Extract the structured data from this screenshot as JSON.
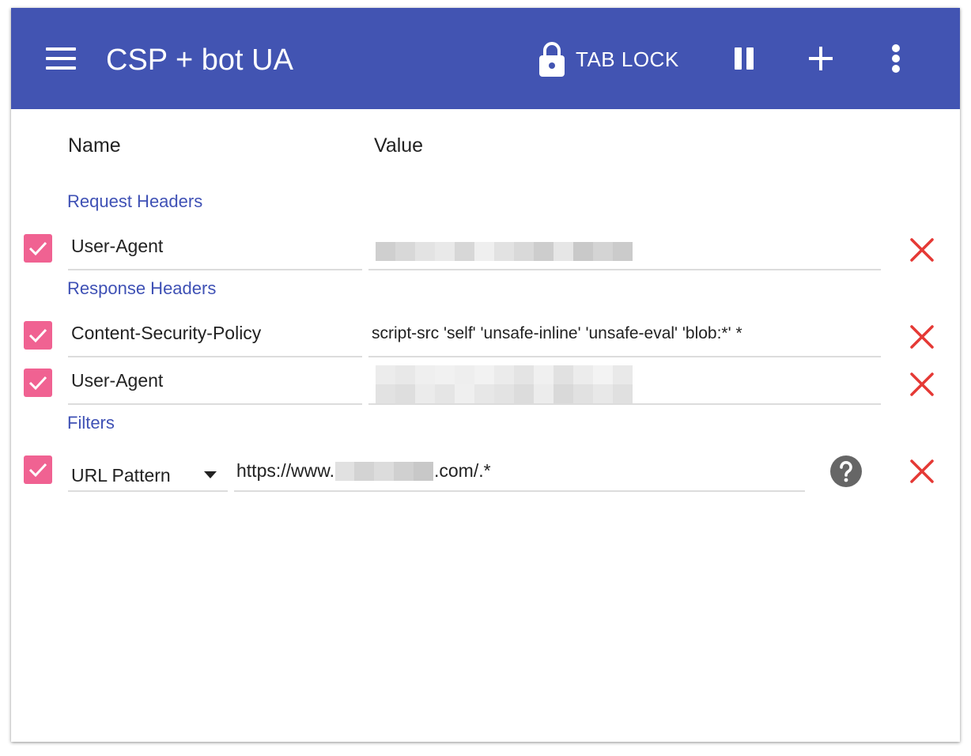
{
  "app": {
    "title": "CSP + bot UA",
    "menu_icon": "hamburger-menu-icon",
    "tab_lock_label": "TAB LOCK",
    "actions": [
      "lock-icon",
      "pause-icon",
      "add-icon",
      "more-vert-icon"
    ]
  },
  "columns": {
    "name": "Name",
    "value": "Value"
  },
  "sections": {
    "request": "Request Headers",
    "response": "Response Headers",
    "filters": "Filters"
  },
  "request_headers": [
    {
      "enabled": true,
      "name": "User-Agent",
      "value": "",
      "value_redacted": true
    }
  ],
  "response_headers": [
    {
      "enabled": true,
      "name": "Content-Security-Policy",
      "value": "script-src 'self' 'unsafe-inline' 'unsafe-eval' 'blob:*' *"
    },
    {
      "enabled": true,
      "name": "User-Agent",
      "value": "",
      "value_redacted": true
    }
  ],
  "filters": [
    {
      "enabled": true,
      "type": "URL Pattern",
      "value_prefix": "https://www.",
      "value_suffix": ".com/.*",
      "value_redacted_part": true
    }
  ],
  "colors": {
    "appbar": "#4254b2",
    "section_text": "#3f51b5",
    "checkbox": "#f06292",
    "delete": "#e53935"
  }
}
